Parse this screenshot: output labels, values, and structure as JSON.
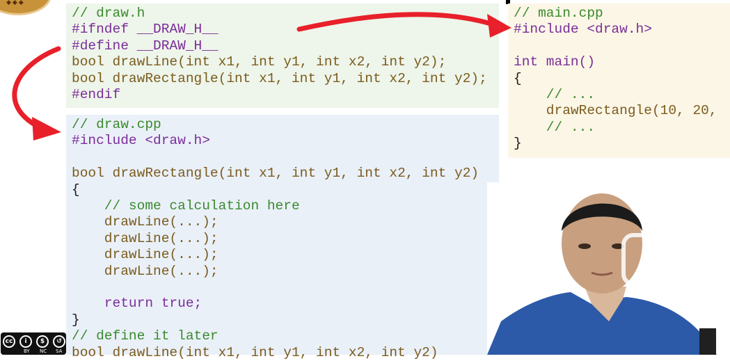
{
  "draw_h": {
    "lines": [
      "// draw.h",
      "#ifndef __DRAW_H__",
      "#define __DRAW_H__",
      "bool drawLine(int x1, int y1, int x2, int y2);",
      "bool drawRectangle(int x1, int y1, int x2, int y2);",
      "#endif"
    ]
  },
  "draw_cpp": {
    "lines": [
      "// draw.cpp",
      "#include <draw.h>",
      "",
      "bool drawRectangle(int x1, int y1, int x2, int y2)",
      "{",
      "    // some calculation here",
      "    drawLine(...);",
      "    drawLine(...);",
      "    drawLine(...);",
      "    drawLine(...);",
      "",
      "    return true;",
      "}",
      "// define it later",
      "bool drawLine(int x1, int y1, int x2, int y2)"
    ]
  },
  "main_cpp": {
    "lines": [
      "// main.cpp",
      "#include <draw.h>",
      "",
      "int main()",
      "{",
      "    // ...",
      "    drawRectangle(10, 20,",
      "    // ...",
      "}"
    ]
  },
  "badge": {
    "labels": [
      "BY",
      "NC",
      "SA"
    ]
  },
  "colors": {
    "arrow": "#e8202a",
    "panel_header": "#eef5ea",
    "panel_source": "#eaf0f8",
    "panel_main": "#fbf6e6"
  },
  "icons": {
    "arrow_top": "curved-arrow-icon",
    "arrow_left": "curved-arrow-icon",
    "play": "play-icon"
  }
}
